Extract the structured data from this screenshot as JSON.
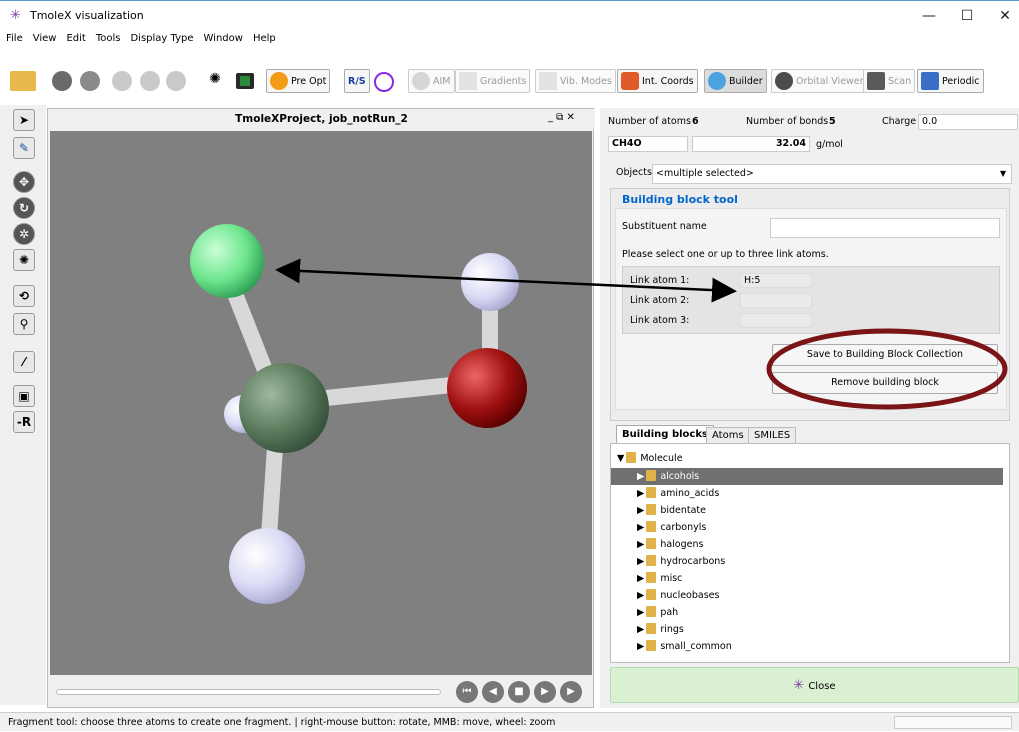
{
  "window": {
    "title": "TmoleX visualization",
    "min": "—",
    "max": "☐",
    "close": "✕"
  },
  "menu": [
    "File",
    "View",
    "Edit",
    "Tools",
    "Display Type",
    "Window",
    "Help"
  ],
  "toolbar": {
    "preopt": "Pre Opt",
    "rs": "R/S",
    "aim": "AIM",
    "gradients": "Gradients",
    "vibmodes": "Vib. Modes",
    "intcoords": "Int. Coords",
    "builder": "Builder",
    "orbital": "Orbital Viewer",
    "scan": "Scan",
    "periodic": "Periodic"
  },
  "lefttools": [
    "Move",
    "Rotate",
    "Zoom",
    "Fit",
    "Bond",
    "-R"
  ],
  "viewport": {
    "title": "TmoleXProject, job_notRun_2",
    "controls": "_ ⧉ ✕"
  },
  "molinfo": {
    "atoms_label": "Number of atoms",
    "atoms": "6",
    "bonds_label": "Number of bonds",
    "bonds": "5",
    "charge_label": "Charge",
    "charge": "0.0",
    "formula": "CH4O",
    "mass": "32.04",
    "mass_unit": "g/mol"
  },
  "objects": {
    "label": "Objects",
    "value": "<multiple selected>"
  },
  "bbtool": {
    "title": "Building block tool",
    "subst_label": "Substituent name",
    "subst_value": "",
    "hint": "Please select one or up to three link atoms.",
    "link1_label": "Link atom 1:",
    "link1": "H:5",
    "link2_label": "Link atom 2:",
    "link2": "",
    "link3_label": "Link atom 3:",
    "link3": "",
    "save_btn": "Save to Building Block Collection",
    "remove_btn": "Remove building block"
  },
  "tabs": [
    "Building blocks",
    "Atoms",
    "SMILES"
  ],
  "tree": {
    "root": "Molecule",
    "items": [
      "alcohols",
      "amino_acids",
      "bidentate",
      "carbonyls",
      "halogens",
      "hydrocarbons",
      "misc",
      "nucleobases",
      "pah",
      "rings",
      "small_common"
    ],
    "selected": "alcohols"
  },
  "close_btn": "Close",
  "status": "Fragment tool: choose three atoms to create one fragment. | right-mouse button: rotate, MMB: move, wheel: zoom",
  "colors": {
    "accent": "#0066cc",
    "selected": "#707070",
    "annotation": "#7b1416",
    "close_bg": "#d9f0d2"
  }
}
